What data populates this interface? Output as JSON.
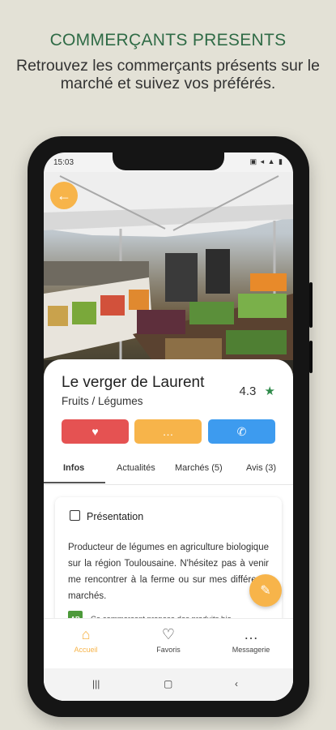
{
  "promo": {
    "headline": "COMMERÇANTS PRESENTS",
    "subline": "Retrouvez les commerçants présents sur le marché et suivez vos préférés."
  },
  "status_bar": {
    "time": "15:03",
    "icons": "▣ ◂ ▲ ▮"
  },
  "hero": {
    "back_icon": "←"
  },
  "vendor": {
    "name": "Le verger de Laurent",
    "category": "Fruits / Légumes",
    "rating": "4.3",
    "rating_icon": "★"
  },
  "actions": {
    "favorite_icon": "♥",
    "message_icon": "…",
    "call_icon": "✆"
  },
  "tabs": [
    {
      "label": "Infos",
      "active": true
    },
    {
      "label": "Actualités"
    },
    {
      "label": "Marchés (5)"
    },
    {
      "label": "Avis (3)"
    }
  ],
  "presentation": {
    "title": "Présentation",
    "text": "Producteur de légumes en agriculture biologique sur la région Toulousaine. N'hésitez pas à venir me rencontrer à la ferme ou sur mes différents marchés.",
    "bio_logo": "AB",
    "bio_text": "Ce commerçant propose des produits bio"
  },
  "fab_icon": "✎",
  "bottom_nav": [
    {
      "label": "Accueil",
      "icon": "⌂",
      "active": true
    },
    {
      "label": "Favoris",
      "icon": "♡"
    },
    {
      "label": "Messagerie",
      "icon": "…"
    }
  ],
  "system_nav": {
    "recent": "|||",
    "home": "▢",
    "back": "‹"
  },
  "colors": {
    "brand_green": "#2f6b46",
    "accent_orange": "#f7b44a",
    "favorite_red": "#e55252",
    "call_blue": "#3d9bef"
  }
}
